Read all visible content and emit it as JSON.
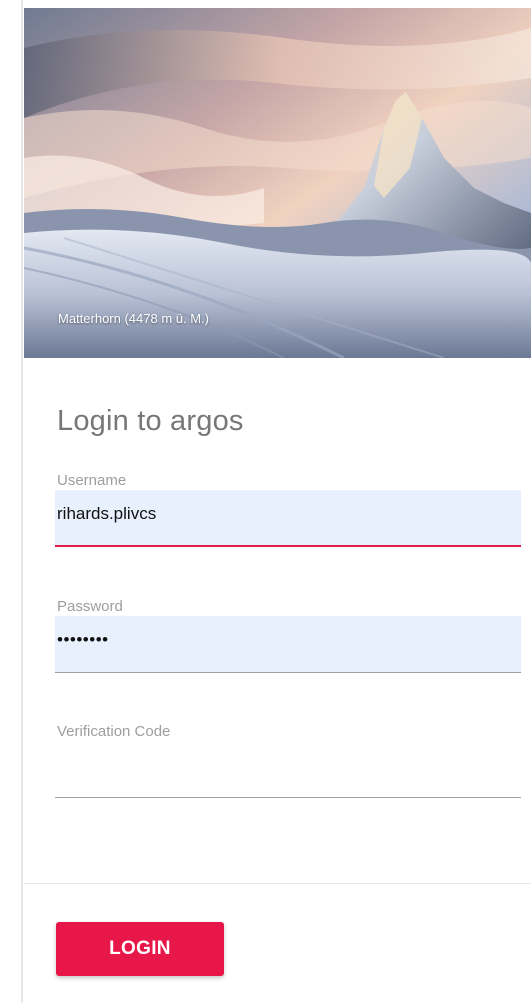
{
  "hero": {
    "caption": "Matterhorn (4478 m ü. M.)"
  },
  "login": {
    "title": "Login to argos",
    "username": {
      "label": "Username",
      "value": "rihards.plivcs"
    },
    "password": {
      "label": "Password",
      "value": "••••••••"
    },
    "verification": {
      "label": "Verification Code",
      "value": ""
    },
    "submit_label": "LOGIN"
  },
  "colors": {
    "accent": "#e8174a",
    "autofill_bg": "#e8f0fe",
    "label": "#9e9e9e"
  }
}
